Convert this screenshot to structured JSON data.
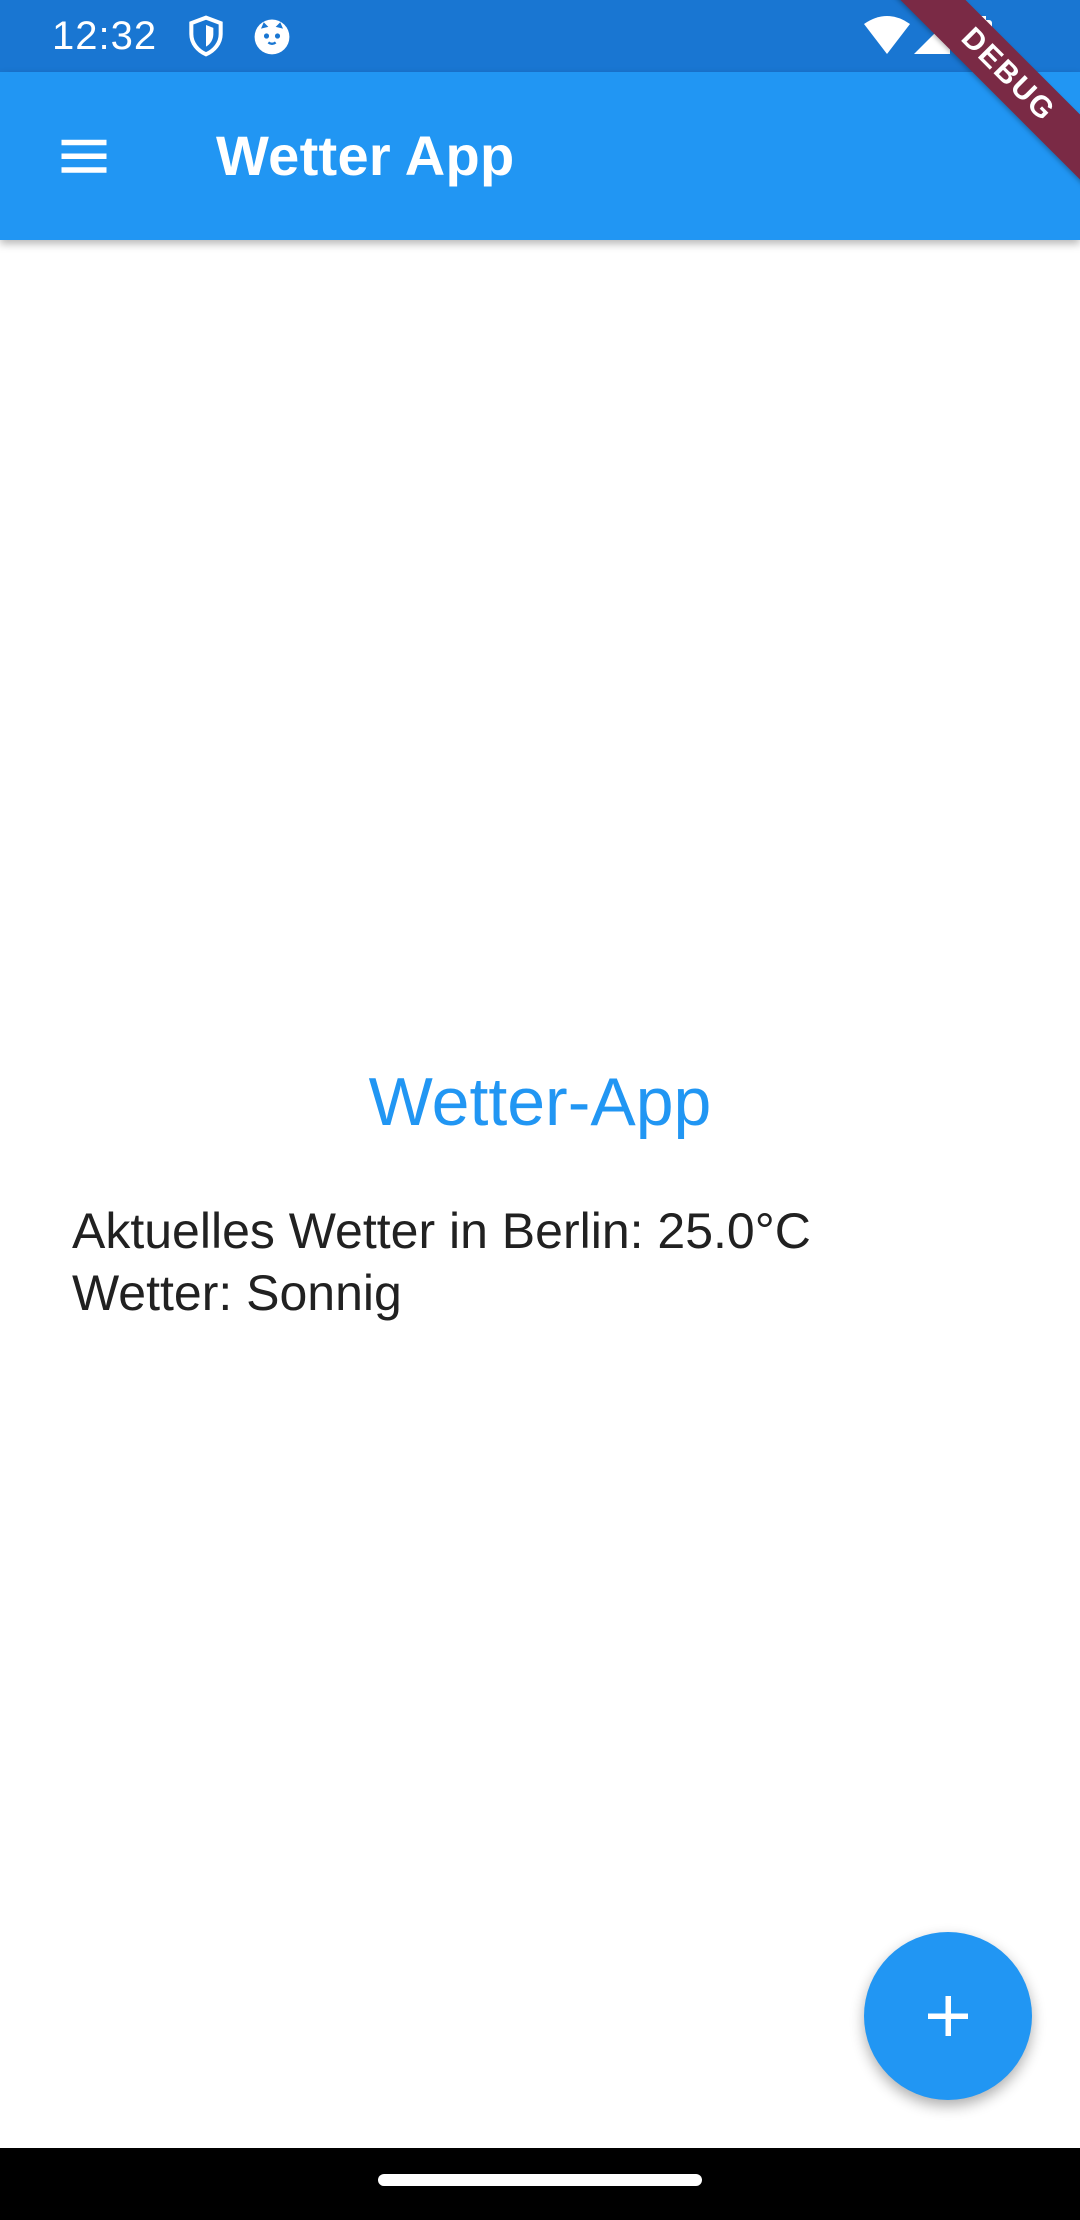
{
  "status_bar": {
    "time": "12:32",
    "left_icons": [
      "shield-icon",
      "cat-face-icon"
    ],
    "right_icons": [
      "wifi-icon",
      "cell-signal-icon",
      "battery-icon"
    ]
  },
  "debug_banner": {
    "label": "DEBUG"
  },
  "app_bar": {
    "title": "Wetter App",
    "menu_icon": "menu-icon"
  },
  "main": {
    "heading": "Wetter-App",
    "weather_line": "Aktuelles Wetter in Berlin: 25.0°C",
    "condition_line": "Wetter: Sonnig"
  },
  "fab": {
    "icon": "plus-icon"
  },
  "colors": {
    "primary": "#2196F3",
    "status_bar": "#1976D2",
    "debug_banner": "#7a2a45",
    "text": "#212121"
  }
}
